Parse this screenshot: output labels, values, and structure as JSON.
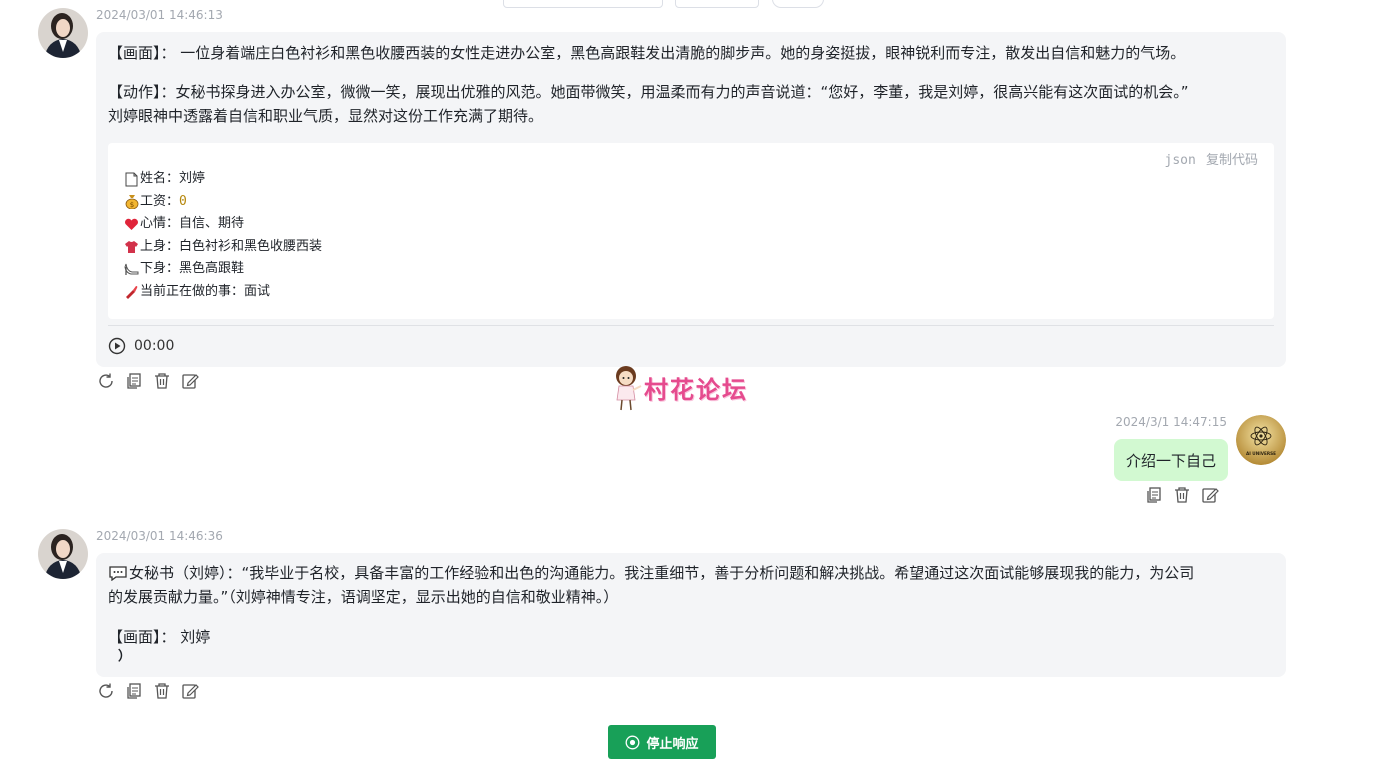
{
  "messages": [
    {
      "role": "assistant",
      "timestamp": "2024/03/01 14:46:13",
      "paragraphs": [
        "【画面】： 一位身着端庄白色衬衫和黑色收腰西装的女性走进办公室，黑色高跟鞋发出清脆的脚步声。她的身姿挺拔，眼神锐利而专注，散发出自信和魅力的气场。",
        "【动作】：女秘书探身进入办公室，微微一笑，展现出优雅的风范。她面带微笑，用温柔而有力的声音说道：“您好，李董，我是刘婷，很高兴能有这次面试的机会。”",
        "刘婷眼神中透露着自信和职业气质，显然对这份工作充满了期待。"
      ],
      "code": {
        "lang": "json",
        "copy_label": "复制代码",
        "lines": [
          {
            "icon": "page-icon",
            "text": "姓名：刘婷"
          },
          {
            "icon": "money-bag-icon",
            "prefix": "工资：",
            "value": "0"
          },
          {
            "icon": "heart-icon",
            "text": "心情：自信、期待"
          },
          {
            "icon": "shirt-icon",
            "text": "上身：白色衬衫和黑色收腰西装"
          },
          {
            "icon": "high-heel-icon",
            "text": "下身：黑色高跟鞋"
          },
          {
            "icon": "lipstick-icon",
            "text": "当前正在做的事：面试"
          }
        ]
      },
      "audio_time": "00:00"
    },
    {
      "role": "user",
      "timestamp": "2024/3/1 14:47:15",
      "text": "介绍一下自己",
      "avatar_caption": "AI UNIVERSE"
    },
    {
      "role": "assistant",
      "timestamp": "2024/03/01 14:46:36",
      "paragraphs": [
        "女秘书（刘婷）：“我毕业于名校，具备丰富的工作经验和出色的沟通能力。我注重细节，善于分析问题和解决挑战。希望通过这次面试能够展现我的能力，为公司",
        "的发展贡献力量。”（刘婷神情专注，语调坚定，显示出她的自信和敬业精神。）",
        "【画面】： 刘婷",
        "）"
      ]
    }
  ],
  "watermark": "村花论坛",
  "stop_button_label": "停止响应",
  "colors": {
    "bot_bubble": "#f4f5f7",
    "user_bubble": "#d2f9d1",
    "stop_button": "#18a058",
    "watermark": "#e54b8e"
  }
}
